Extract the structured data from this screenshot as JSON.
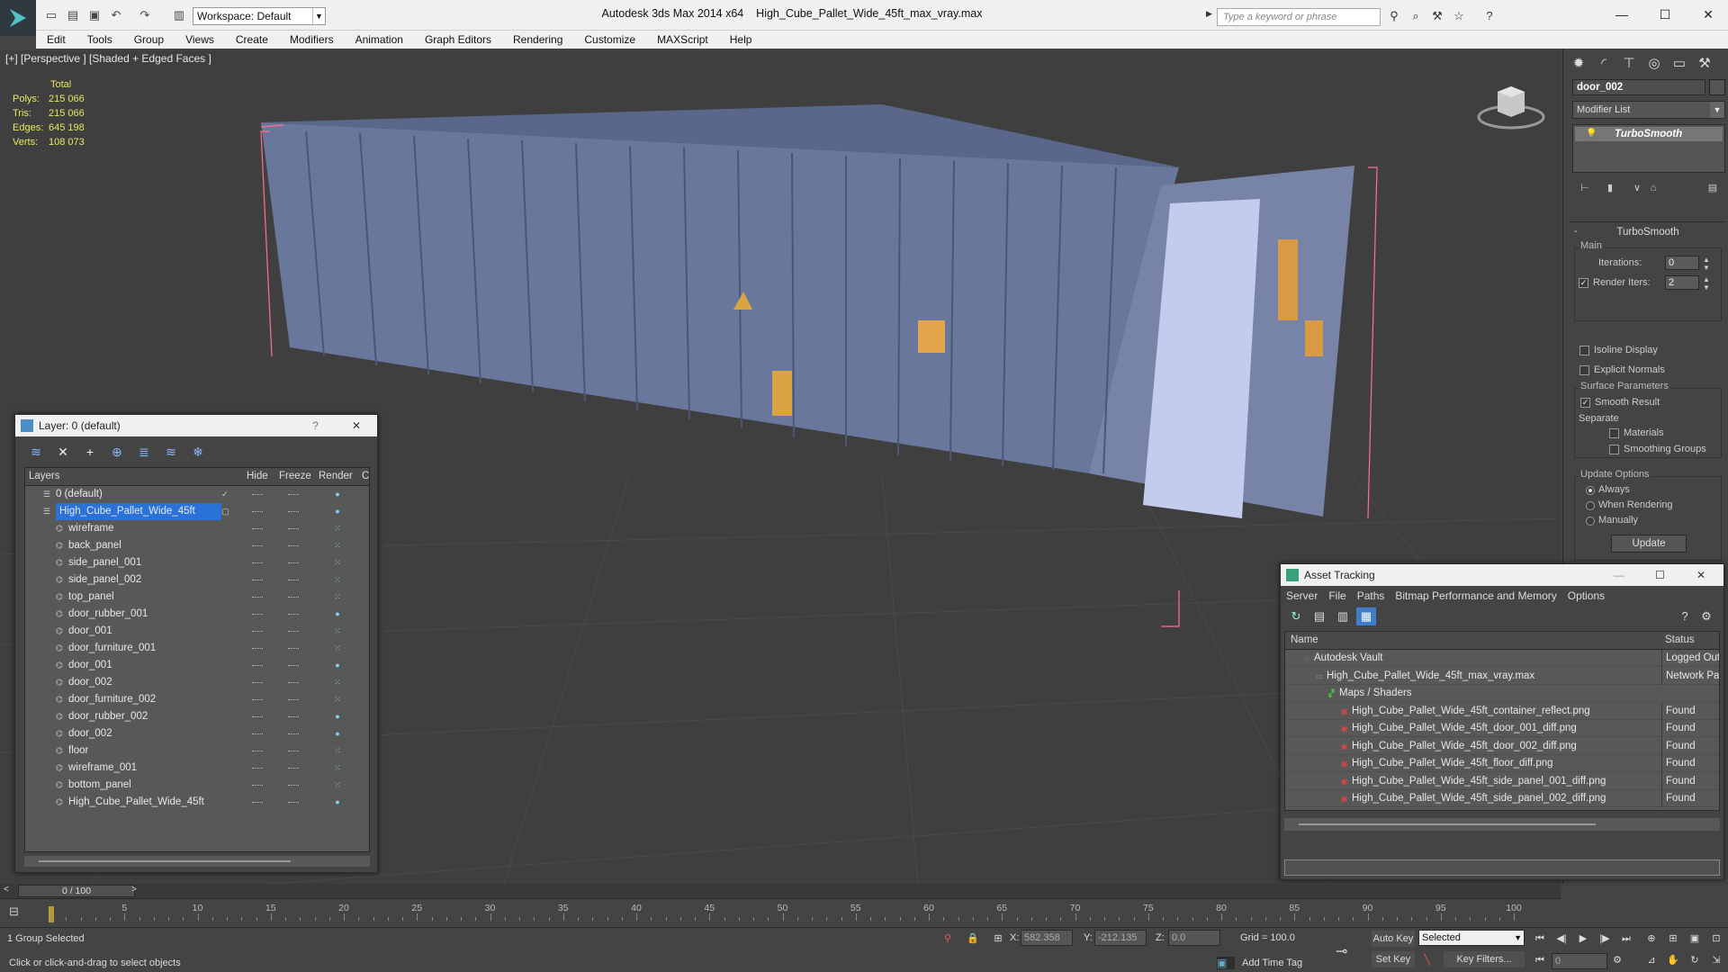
{
  "app": {
    "title": "Autodesk 3ds Max  2014 x64",
    "file": "High_Cube_Pallet_Wide_45ft_max_vray.max",
    "workspace": "Workspace: Default",
    "search_placeholder": "Type a keyword or phrase"
  },
  "menu": [
    "Edit",
    "Tools",
    "Group",
    "Views",
    "Create",
    "Modifiers",
    "Animation",
    "Graph Editors",
    "Rendering",
    "Customize",
    "MAXScript",
    "Help"
  ],
  "viewport": {
    "label": "[+] [Perspective ] [Shaded + Edged Faces ]",
    "stats": {
      "header": "Total",
      "rows": [
        {
          "label": "Polys:",
          "value": "215 066"
        },
        {
          "label": "Tris:",
          "value": "215 066"
        },
        {
          "label": "Edges:",
          "value": "645 198"
        },
        {
          "label": "Verts:",
          "value": "108 073"
        }
      ]
    }
  },
  "command_panel": {
    "object_name": "door_002",
    "modifier_list": "Modifier List",
    "stack_item": "TurboSmooth",
    "rollout_title": "TurboSmooth",
    "main_group": "Main",
    "iterations_label": "Iterations:",
    "iterations_value": "0",
    "render_iters_label": "Render Iters:",
    "render_iters_value": "2",
    "isoline": "Isoline Display",
    "explicit_normals": "Explicit Normals",
    "surface_group": "Surface Parameters",
    "smooth_result": "Smooth Result",
    "separate": "Separate",
    "materials": "Materials",
    "smoothing_groups": "Smoothing Groups",
    "update_group": "Update Options",
    "always": "Always",
    "when_rendering": "When Rendering",
    "manually": "Manually",
    "update_button": "Update"
  },
  "layer_dialog": {
    "title": "Layer: 0 (default)",
    "columns": [
      "Layers",
      "Hide",
      "Freeze",
      "Render",
      "C"
    ],
    "layers": [
      {
        "name": "0 (default)",
        "level": 0,
        "selected": false
      },
      {
        "name": "High_Cube_Pallet_Wide_45ft",
        "level": 0,
        "selected": true
      },
      {
        "name": "wireframe",
        "level": 1,
        "selected": false
      },
      {
        "name": "back_panel",
        "level": 1,
        "selected": false
      },
      {
        "name": "side_panel_001",
        "level": 1,
        "selected": false
      },
      {
        "name": "side_panel_002",
        "level": 1,
        "selected": false
      },
      {
        "name": "top_panel",
        "level": 1,
        "selected": false
      },
      {
        "name": "door_rubber_001",
        "level": 1,
        "selected": false
      },
      {
        "name": "door_001",
        "level": 1,
        "selected": false
      },
      {
        "name": "door_furniture_001",
        "level": 1,
        "selected": false
      },
      {
        "name": "door_001",
        "level": 1,
        "selected": false
      },
      {
        "name": "door_002",
        "level": 1,
        "selected": false
      },
      {
        "name": "door_furniture_002",
        "level": 1,
        "selected": false
      },
      {
        "name": "door_rubber_002",
        "level": 1,
        "selected": false
      },
      {
        "name": "door_002",
        "level": 1,
        "selected": false
      },
      {
        "name": "floor",
        "level": 1,
        "selected": false
      },
      {
        "name": "wireframe_001",
        "level": 1,
        "selected": false
      },
      {
        "name": "bottom_panel",
        "level": 1,
        "selected": false
      },
      {
        "name": "High_Cube_Pallet_Wide_45ft",
        "level": 1,
        "selected": false
      }
    ]
  },
  "asset_dialog": {
    "title": "Asset Tracking",
    "menu": [
      "Server",
      "File",
      "Paths",
      "Bitmap Performance and Memory",
      "Options"
    ],
    "columns": [
      "Name",
      "Status"
    ],
    "rows": [
      {
        "name": "Autodesk Vault",
        "status": "Logged Out",
        "level": 0
      },
      {
        "name": "High_Cube_Pallet_Wide_45ft_max_vray.max",
        "status": "Network Pa",
        "level": 1
      },
      {
        "name": "Maps / Shaders",
        "status": "",
        "level": 2
      },
      {
        "name": "High_Cube_Pallet_Wide_45ft_container_reflect.png",
        "status": "Found",
        "level": 3
      },
      {
        "name": "High_Cube_Pallet_Wide_45ft_door_001_diff.png",
        "status": "Found",
        "level": 3
      },
      {
        "name": "High_Cube_Pallet_Wide_45ft_door_002_diff.png",
        "status": "Found",
        "level": 3
      },
      {
        "name": "High_Cube_Pallet_Wide_45ft_floor_diff.png",
        "status": "Found",
        "level": 3
      },
      {
        "name": "High_Cube_Pallet_Wide_45ft_side_panel_001_diff.png",
        "status": "Found",
        "level": 3
      },
      {
        "name": "High_Cube_Pallet_Wide_45ft_side_panel_002_diff.png",
        "status": "Found",
        "level": 3
      }
    ]
  },
  "timeline": {
    "frame": "0 / 100",
    "ticks": [
      "5",
      "10",
      "15",
      "20",
      "25",
      "30",
      "35",
      "40",
      "45",
      "50",
      "55",
      "60",
      "65",
      "70",
      "75",
      "80",
      "85",
      "90",
      "95",
      "100"
    ]
  },
  "status": {
    "selection": "1 Group Selected",
    "prompt": "Click or click-and-drag to select objects",
    "x_label": "X:",
    "x_value": "582.358",
    "y_label": "Y:",
    "y_value": "-212.135",
    "z_label": "Z:",
    "z_value": "0.0",
    "grid": "Grid = 100.0",
    "auto_key": "Auto Key",
    "set_key": "Set Key",
    "selected_dropdown": "Selected",
    "key_filters": "Key Filters...",
    "add_time_tag": "Add Time Tag",
    "frame_field": "0"
  },
  "colors": {
    "selection": "#2a72d8",
    "container": "#6c7aa0",
    "bbox": "#ff6b8a",
    "stats": "#e8e860"
  }
}
